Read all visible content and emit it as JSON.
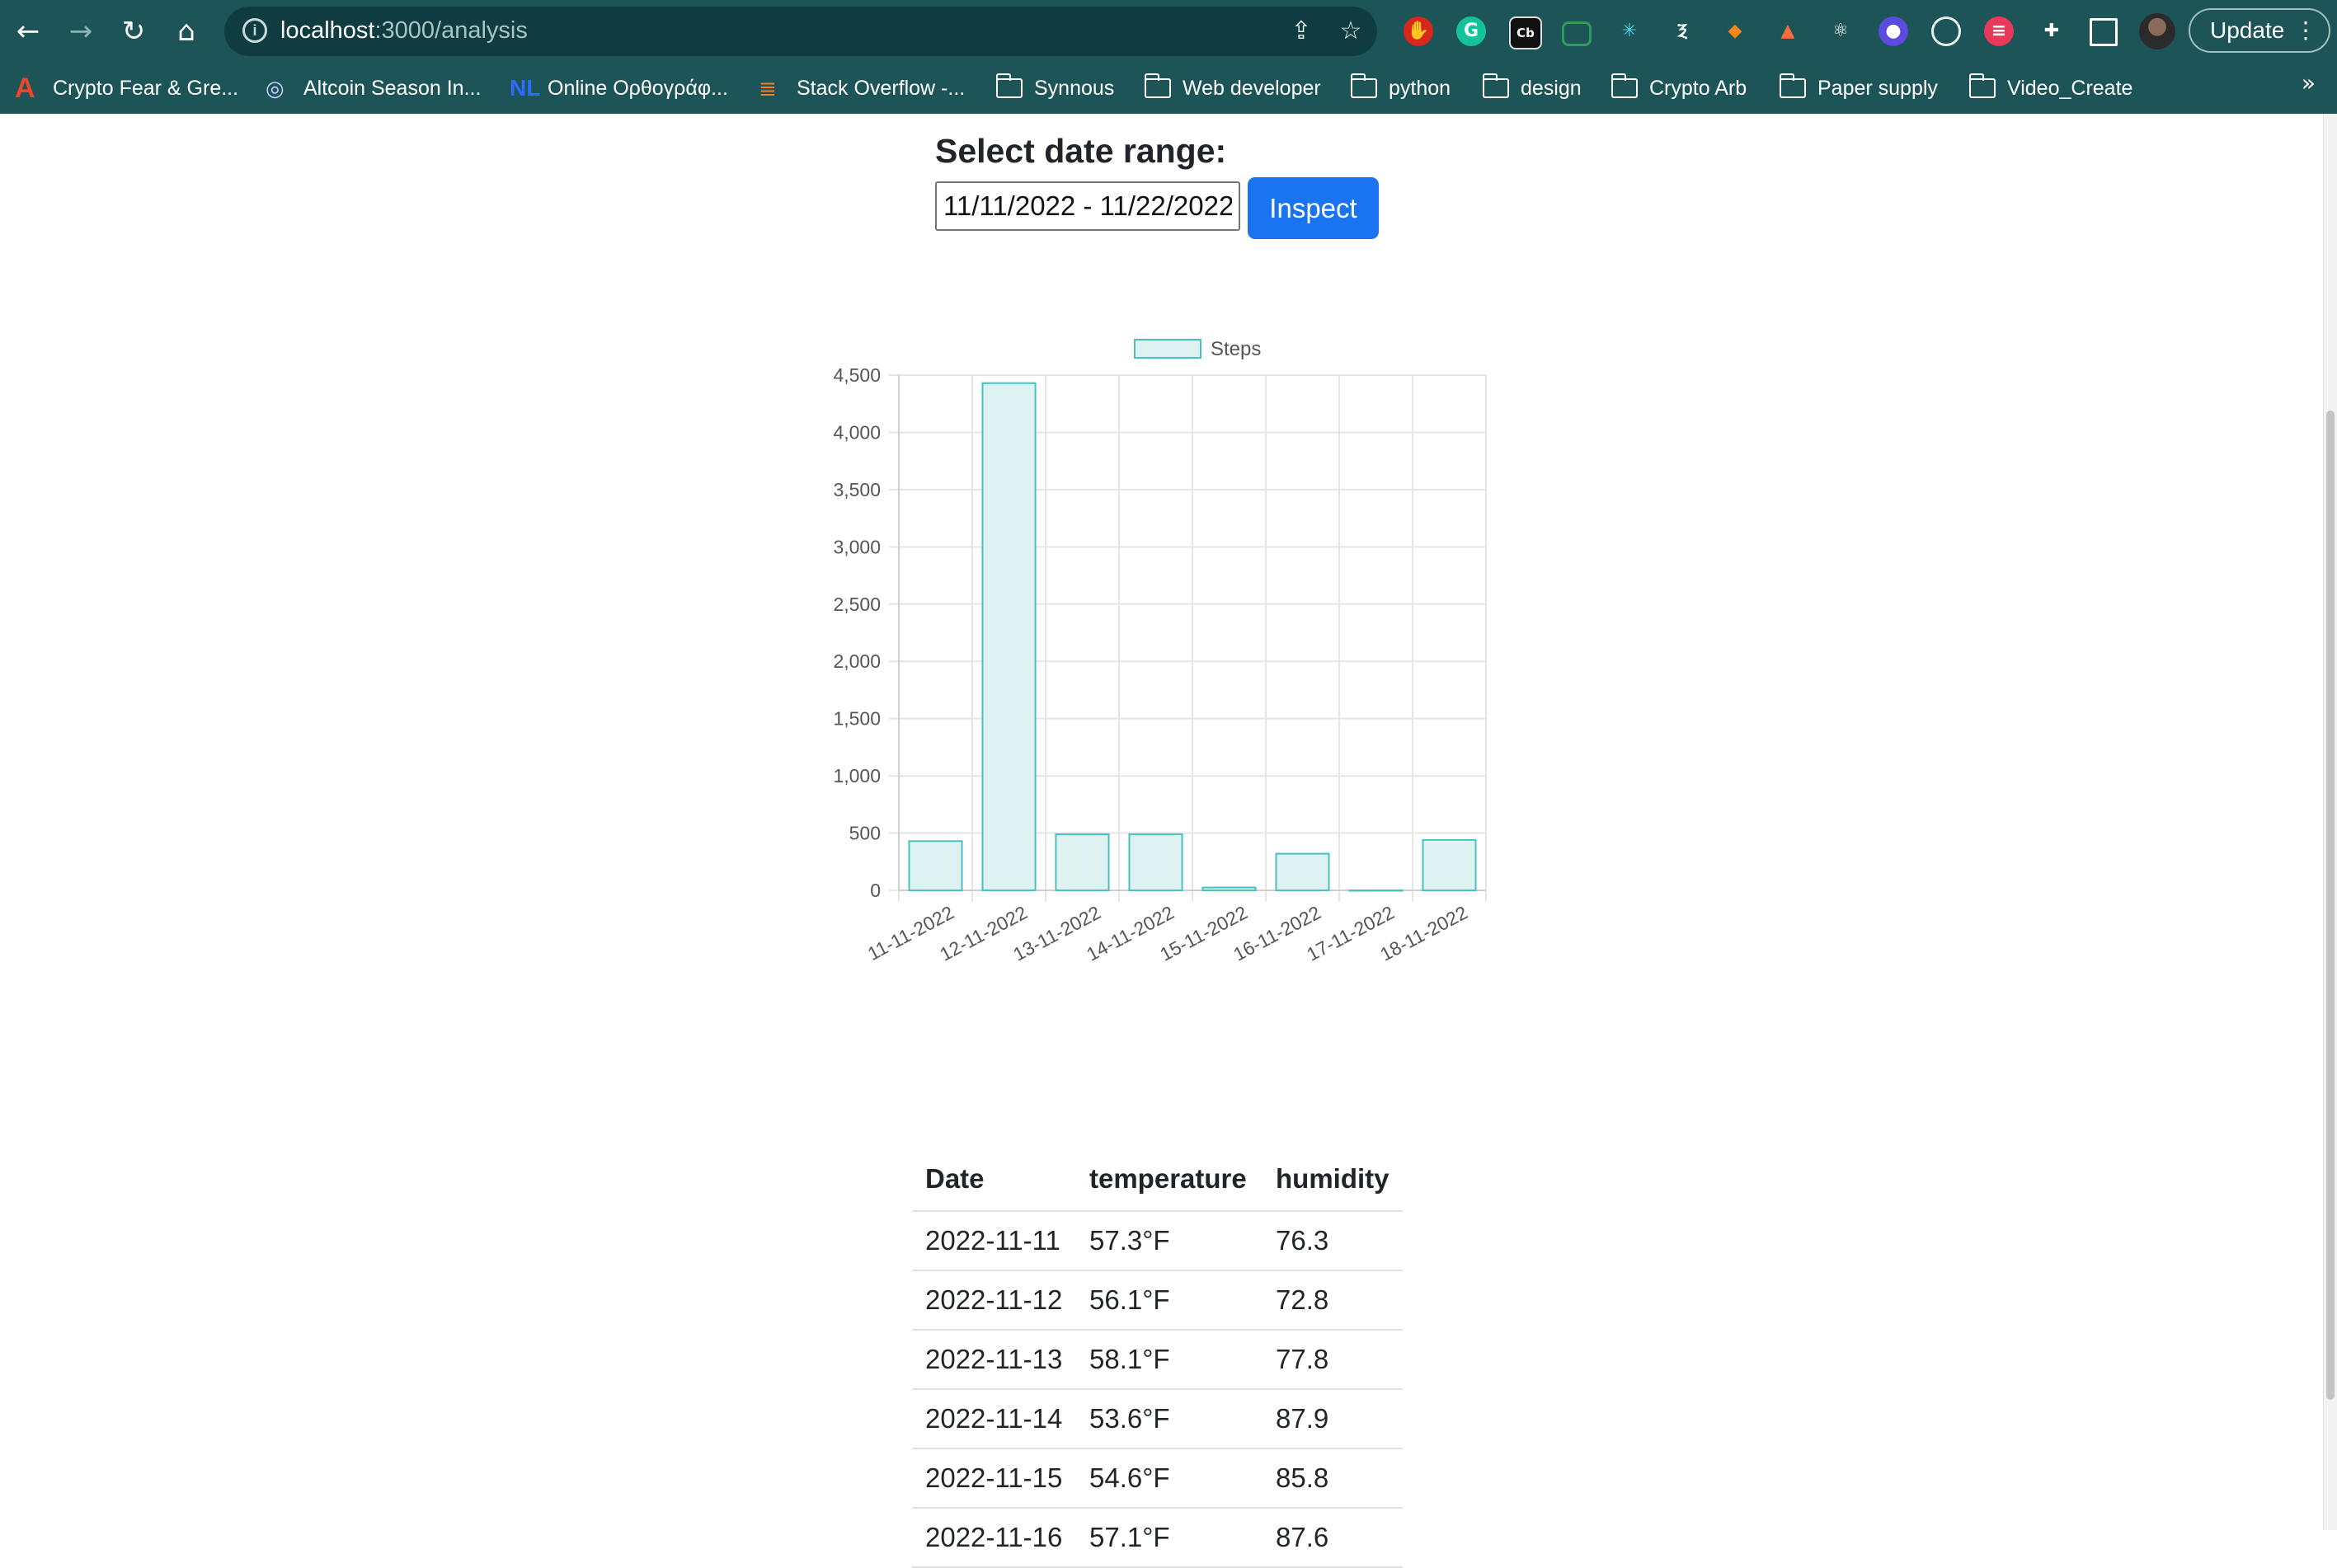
{
  "browser": {
    "url_host": "localhost",
    "url_path": ":3000/analysis",
    "update_label": "Update",
    "bookmarks": [
      {
        "label": "Crypto Fear & Gre...",
        "icon": "a-logo-icon",
        "color": "#e8452c"
      },
      {
        "label": "Altcoin Season In...",
        "icon": "altcoin-logo-icon",
        "color": "#c7d0ff"
      },
      {
        "label": "Online Ορθογράφ...",
        "icon": "nl-logo-icon",
        "color": "#2f6bff"
      },
      {
        "label": "Stack Overflow -...",
        "icon": "stackoverflow-icon",
        "color": "#f48024"
      },
      {
        "label": "Synnous",
        "icon": "folder-icon"
      },
      {
        "label": "Web developer",
        "icon": "folder-icon"
      },
      {
        "label": "python",
        "icon": "folder-icon"
      },
      {
        "label": "design",
        "icon": "folder-icon"
      },
      {
        "label": "Crypto Arb",
        "icon": "folder-icon"
      },
      {
        "label": "Paper supply",
        "icon": "folder-icon"
      },
      {
        "label": "Video_Create",
        "icon": "folder-icon"
      }
    ],
    "more_glyph": "»"
  },
  "form": {
    "label": "Select date range:",
    "date_value": "11/11/2022 - 11/22/2022",
    "button_label": "Inspect"
  },
  "chart_data": {
    "type": "bar",
    "categories": [
      "11-11-2022",
      "12-11-2022",
      "13-11-2022",
      "14-11-2022",
      "15-11-2022",
      "16-11-2022",
      "17-11-2022",
      "18-11-2022"
    ],
    "series": [
      {
        "name": "Steps",
        "values": [
          430,
          4430,
          490,
          490,
          25,
          320,
          0,
          440
        ]
      }
    ],
    "ylim": [
      0,
      4500
    ],
    "yticks": [
      0,
      500,
      1000,
      1500,
      2000,
      2500,
      3000,
      3500,
      4000,
      4500
    ],
    "ytick_labels": [
      "0",
      "500",
      "1,000",
      "1,500",
      "2,000",
      "2,500",
      "3,000",
      "3,500",
      "4,000",
      "4,500"
    ],
    "legend_position": "top",
    "grid": true,
    "colors": {
      "fill": "#dff2f2",
      "stroke": "#4bc0c0"
    }
  },
  "table": {
    "headers": [
      "Date",
      "temperature",
      "humidity"
    ],
    "rows": [
      [
        "2022-11-11",
        "57.3°F",
        "76.3"
      ],
      [
        "2022-11-12",
        "56.1°F",
        "72.8"
      ],
      [
        "2022-11-13",
        "58.1°F",
        "77.8"
      ],
      [
        "2022-11-14",
        "53.6°F",
        "87.9"
      ],
      [
        "2022-11-15",
        "54.6°F",
        "85.8"
      ],
      [
        "2022-11-16",
        "57.1°F",
        "87.6"
      ]
    ]
  }
}
